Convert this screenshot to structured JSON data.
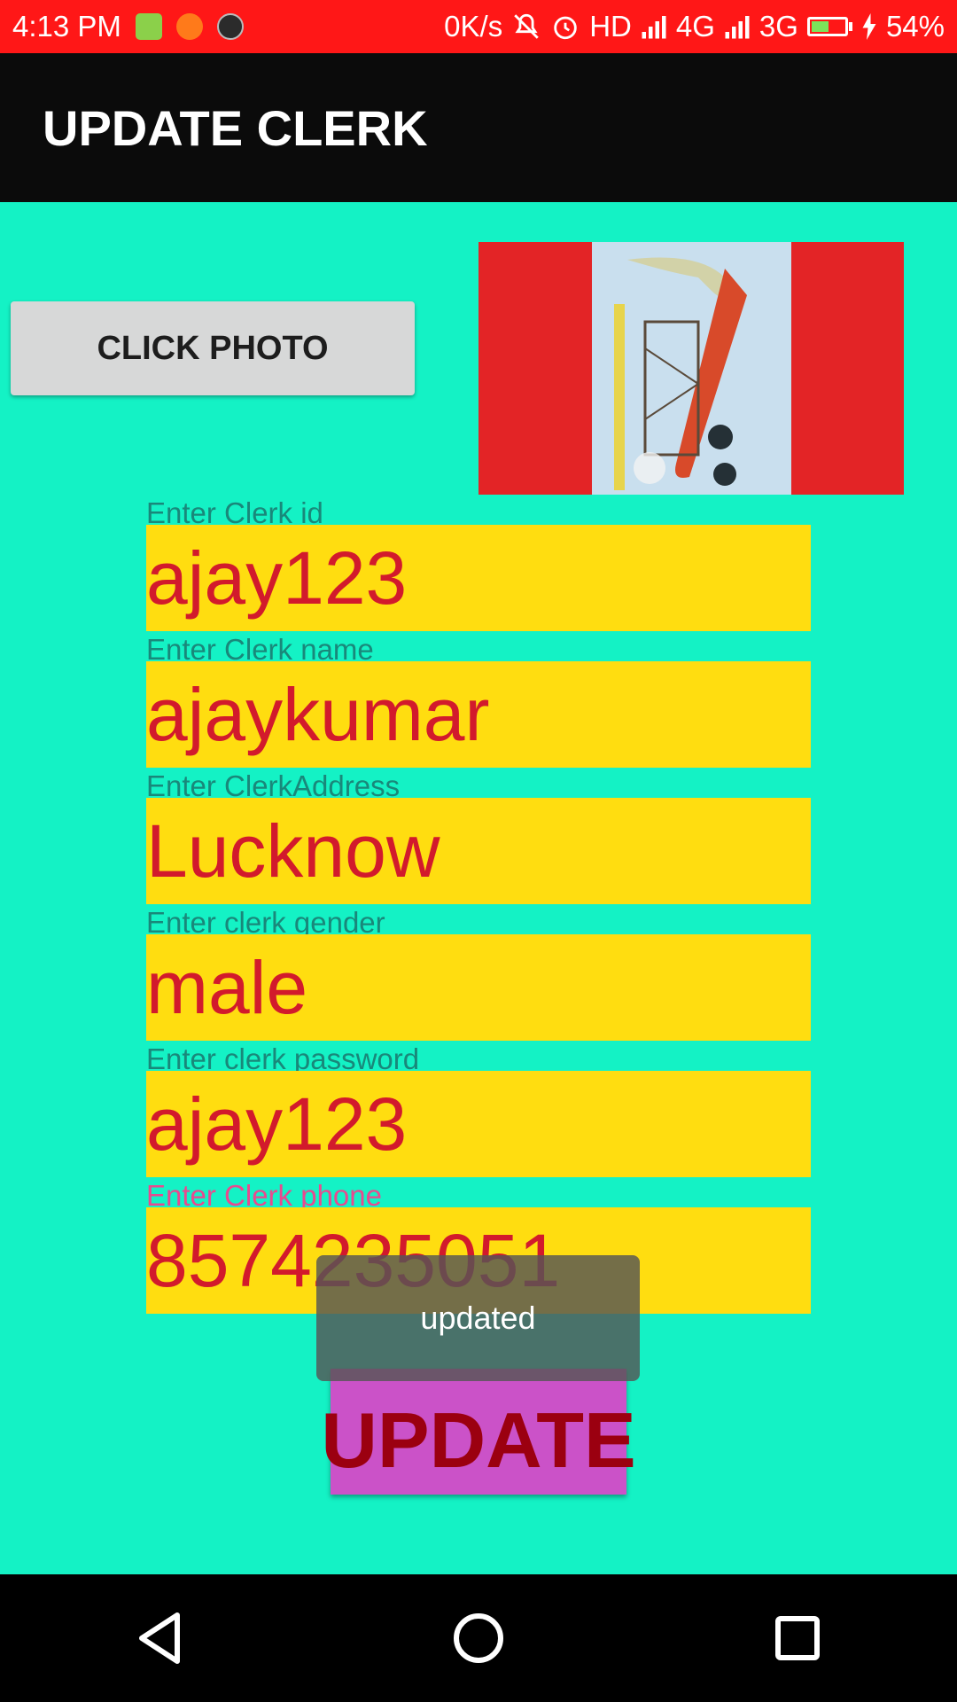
{
  "status_bar": {
    "time": "4:13 PM",
    "net_speed": "0K/s",
    "network_labels": [
      "HD",
      "4G",
      "3G"
    ],
    "battery_text": "54%",
    "battery_level": 0.54,
    "icons": [
      "app-notification-icon",
      "crop-icon",
      "call-recorder-icon",
      "mute-icon",
      "alarm-icon",
      "signal-icon",
      "battery-icon",
      "charging-icon"
    ]
  },
  "app_bar": {
    "title": "UPDATE CLERK"
  },
  "photo": {
    "button_label": "CLICK PHOTO"
  },
  "form": {
    "fields": [
      {
        "label": "Enter Clerk id",
        "value": "ajay123"
      },
      {
        "label": "Enter Clerk name",
        "value": "ajaykumar"
      },
      {
        "label": "Enter ClerkAddress",
        "value": "Lucknow"
      },
      {
        "label": "Enter clerk gender",
        "value": "male"
      },
      {
        "label": "Enter clerk password",
        "value": "ajay123"
      },
      {
        "label": "Enter Clerk phone",
        "value": "8574235051"
      }
    ],
    "update_label": "UPDATE"
  },
  "toast": {
    "message": "updated"
  },
  "colors": {
    "status_bar": "#FF1717",
    "app_bar": "#0B0B0B",
    "background": "#14F2C5",
    "field_bg": "#FFDD10",
    "field_text": "#D21A2C",
    "label_text": "#19887A",
    "focused_label": "#E84A8F",
    "update_button": "#CB52C8",
    "update_text": "#9B0010",
    "photo_frame": "#E32426"
  }
}
